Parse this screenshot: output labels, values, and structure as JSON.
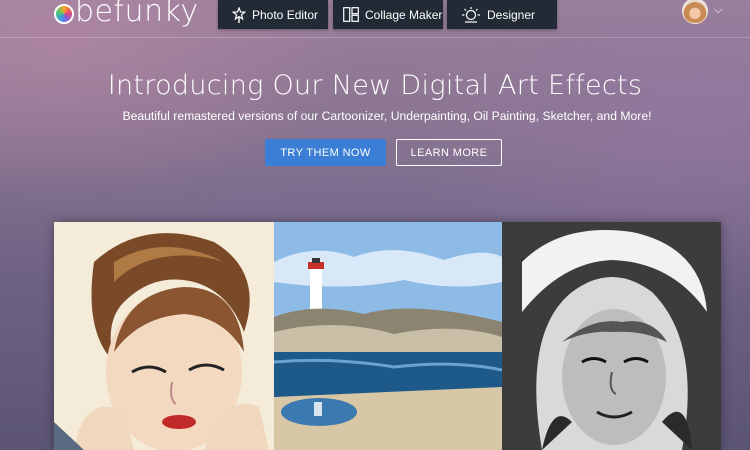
{
  "brand": {
    "logo_text": "befunky"
  },
  "nav": {
    "tabs": [
      {
        "label": "Photo Editor",
        "icon": "magic-wand-icon"
      },
      {
        "label": "Collage Maker",
        "icon": "collage-grid-icon"
      },
      {
        "label": "Designer",
        "icon": "designer-sun-icon"
      }
    ]
  },
  "user": {
    "menu_icon": "chevron-down-icon"
  },
  "hero": {
    "headline": "Introducing Our New Digital Art Effects",
    "subheadline": "Beautiful remastered versions of our Cartoonizer, Underpainting, Oil Painting, Sketcher, and More!",
    "primary_button": "TRY THEM NOW",
    "secondary_button": "LEARN MORE"
  },
  "colors": {
    "nav_bg": "#222a35",
    "primary_button": "#3a7fd5"
  }
}
